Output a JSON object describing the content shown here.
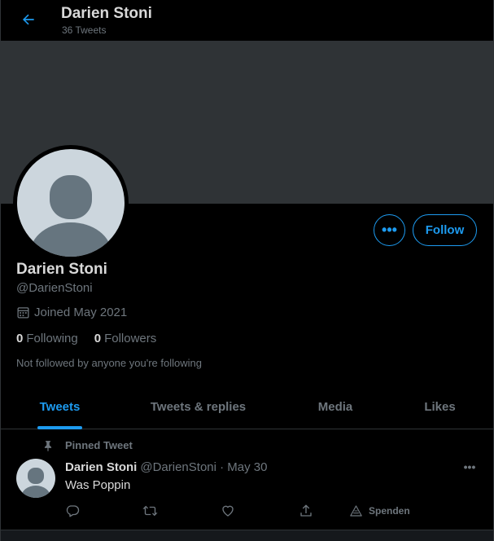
{
  "header": {
    "back_icon": "arrow-left-icon",
    "title": "Darien Stoni",
    "subtitle": "36 Tweets"
  },
  "profile": {
    "display_name": "Darien Stoni",
    "handle": "@DarienStoni",
    "joined": "Joined May 2021",
    "following_count": "0",
    "following_label": "Following",
    "followers_count": "0",
    "followers_label": "Followers",
    "not_followed_text": "Not followed by anyone you're following",
    "more_button_label": "•••",
    "follow_button_label": "Follow"
  },
  "tabs": [
    {
      "label": "Tweets",
      "active": true
    },
    {
      "label": "Tweets & replies",
      "active": false
    },
    {
      "label": "Media",
      "active": false
    },
    {
      "label": "Likes",
      "active": false
    }
  ],
  "tweet": {
    "pinned_label": "Pinned Tweet",
    "author_name": "Darien Stoni",
    "author_meta": "@DarienStoni · May 30",
    "text": "Was Poppin",
    "more_label": "•••",
    "actions": {
      "reply_icon": "reply-icon",
      "retweet_icon": "retweet-icon",
      "like_icon": "heart-icon",
      "share_icon": "share-icon",
      "donate_label": "Spenden"
    }
  },
  "colors": {
    "accent": "#1d9bf0",
    "background": "#000000",
    "banner": "#2f3336",
    "text_primary": "#d9d9d9",
    "text_secondary": "#6e767d"
  }
}
